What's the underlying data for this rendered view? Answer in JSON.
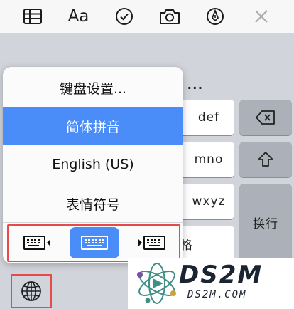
{
  "toolbar": {
    "format_label": "Aa",
    "icons": [
      "table-icon",
      "format-text-icon",
      "checklist-icon",
      "camera-icon",
      "markup-pen-icon",
      "close-icon"
    ]
  },
  "keyboard": {
    "ellipsis": "...",
    "keys": {
      "def": "def",
      "mno": "mno",
      "wxyz": "wxyz",
      "return": "换行",
      "space_partial": "格"
    },
    "icons": {
      "delete": "backspace-icon",
      "shift": "shift-icon",
      "globe": "globe-icon"
    }
  },
  "popup": {
    "items": [
      {
        "label": "键盘设置...",
        "selected": false
      },
      {
        "label": "简体拼音",
        "selected": true
      },
      {
        "label": "English (US)",
        "selected": false
      },
      {
        "label": "表情符号",
        "selected": false
      }
    ],
    "keyboard_modes": [
      {
        "name": "left-handed-keyboard-icon",
        "active": false
      },
      {
        "name": "full-keyboard-icon",
        "active": true
      },
      {
        "name": "right-handed-keyboard-icon",
        "active": false
      }
    ]
  },
  "colors": {
    "accent": "#4a8df8",
    "highlight_border": "#e64a4a",
    "keyboard_bg": "#d1d4da"
  },
  "watermark": {
    "brand": "DS2M",
    "url": "DS2M.COM"
  }
}
